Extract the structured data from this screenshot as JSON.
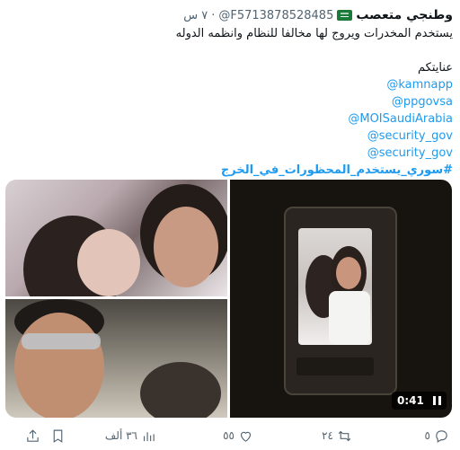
{
  "tweet": {
    "display_name": "وطنجي متعصب",
    "handle": "@F5713878528485",
    "separator": "·",
    "time": "٧ س",
    "lines": [
      "يستخدم المخدرات ويروج لها مخالفا للنظام وانظمه الدوله",
      "",
      "عنايتكم"
    ],
    "mentions": [
      "@kamnapp",
      "@ppgovsa",
      "@MOISaudiArabia",
      "@security_gov",
      "@security_gov"
    ],
    "hashtag": "#سوري_يستخدم_المحظورات_في_الخرج"
  },
  "media": {
    "video_duration": "0:41"
  },
  "actions": {
    "replies": "٥",
    "retweets": "٢٤",
    "likes": "٥٥",
    "views": "٣٦ ألف"
  },
  "icons": [
    "flag-icon",
    "pause-icon",
    "reply-icon",
    "retweet-icon",
    "like-icon",
    "views-icon",
    "bookmark-icon",
    "share-icon"
  ],
  "colors": {
    "link": "#1d9bf0",
    "muted": "#536471",
    "text": "#0f1419"
  }
}
